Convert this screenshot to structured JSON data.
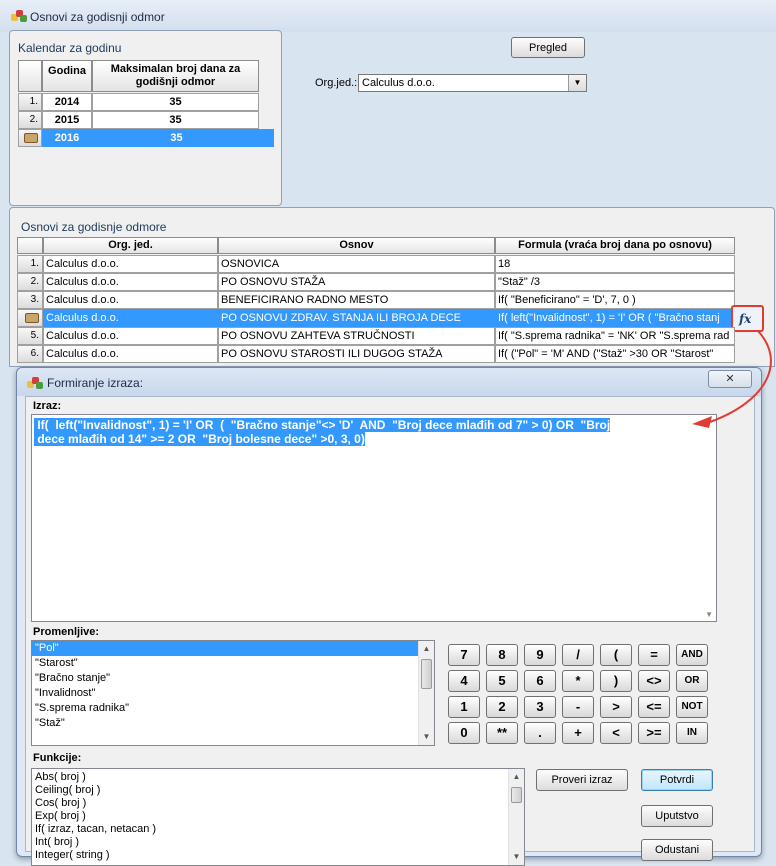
{
  "window": {
    "title": "Osnovi za godisnji odmor"
  },
  "calendar": {
    "title": "Kalendar za godinu",
    "headers": [
      "Godina",
      "Maksimalan broj dana za godišnji odmor"
    ],
    "rows": [
      {
        "num": "1.",
        "year": "2014",
        "days": "35"
      },
      {
        "num": "2.",
        "year": "2015",
        "days": "35"
      },
      {
        "num": "",
        "year": "2016",
        "days": "35"
      }
    ]
  },
  "top_controls": {
    "pregled_label": "Pregled",
    "org_label": "Org.jed.:",
    "org_value": "Calculus d.o.o."
  },
  "osnovi": {
    "title": "Osnovi za godisnje odmore",
    "headers": [
      "Org. jed.",
      "Osnov",
      "Formula  (vraća broj dana po osnovu)"
    ],
    "rows": [
      {
        "num": "1.",
        "org": "Calculus d.o.o.",
        "osnov": "OSNOVICA",
        "formula": "18"
      },
      {
        "num": "2.",
        "org": "Calculus d.o.o.",
        "osnov": "PO OSNOVU STAŽA",
        "formula": "\"Staž\" /3"
      },
      {
        "num": "3.",
        "org": "Calculus d.o.o.",
        "osnov": "BENEFICIRANO RADNO MESTO",
        "formula": "If(  \"Beneficirano\" = 'D', 7, 0 )"
      },
      {
        "num": "",
        "org": "Calculus d.o.o.",
        "osnov": "PO OSNOVU ZDRAV. STANJA ILI BROJA DECE",
        "formula": "If(  left(\"Invalidnost\", 1) = 'I' OR  (  \"Bračno stanj"
      },
      {
        "num": "5.",
        "org": "Calculus d.o.o.",
        "osnov": "PO OSNOVU ZAHTEVA STRUČNOSTI",
        "formula": "If(  \"S.sprema radnika\" = 'NK' OR   \"S.sprema rad"
      },
      {
        "num": "6.",
        "org": "Calculus d.o.o.",
        "osnov": "PO OSNOVU STAROSTI ILI DUGOG STAŽA",
        "formula": "If(   (\"Pol\" = 'M'   AND  (\"Staž\" >30 OR  \"Starost\""
      }
    ],
    "fx_label": "fx"
  },
  "dialog": {
    "title": "Formiranje izraza:",
    "close_label": "✕",
    "izraz_label": "Izraz:",
    "izraz_line1": " If(  left(\"Invalidnost\", 1) = 'I' OR  (  \"Bračno stanje\"<> 'D'  AND  \"Broj dece mlađih od 7\" > 0) OR  \"Broj",
    "izraz_line2": " dece mlađih od 14\" >= 2 OR  \"Broj bolesne dece\" >0, 3, 0)",
    "promenljive_label": "Promenljive:",
    "variables": [
      "\"Pol\"",
      "\"Starost\"",
      "\"Bračno stanje\"",
      "\"Invalidnost\"",
      "\"S.sprema radnika\"",
      "\"Staž\""
    ],
    "funkcije_label": "Funkcije:",
    "functions": [
      "Abs( broj )",
      "Ceiling( broj )",
      "Cos( broj )",
      "Exp( broj )",
      "If( izraz, tacan, netacan )",
      "Int( broj )",
      "Integer( string )"
    ],
    "calc_rows": [
      [
        "7",
        "8",
        "9",
        "/",
        "(",
        "=",
        "AND"
      ],
      [
        "4",
        "5",
        "6",
        "*",
        ")",
        "<>",
        "OR"
      ],
      [
        "1",
        "2",
        "3",
        "-",
        ">",
        "<=",
        "NOT"
      ],
      [
        "0",
        "**",
        ".",
        "+",
        "<",
        ">=",
        "IN"
      ]
    ],
    "proveri_label": "Proveri izraz",
    "potvrdi_label": "Potvrdi",
    "uputstvo_label": "Uputstvo",
    "odustani_label": "Odustani"
  },
  "colors": {
    "selection": "#3399ff",
    "arrow": "#e03c31"
  }
}
